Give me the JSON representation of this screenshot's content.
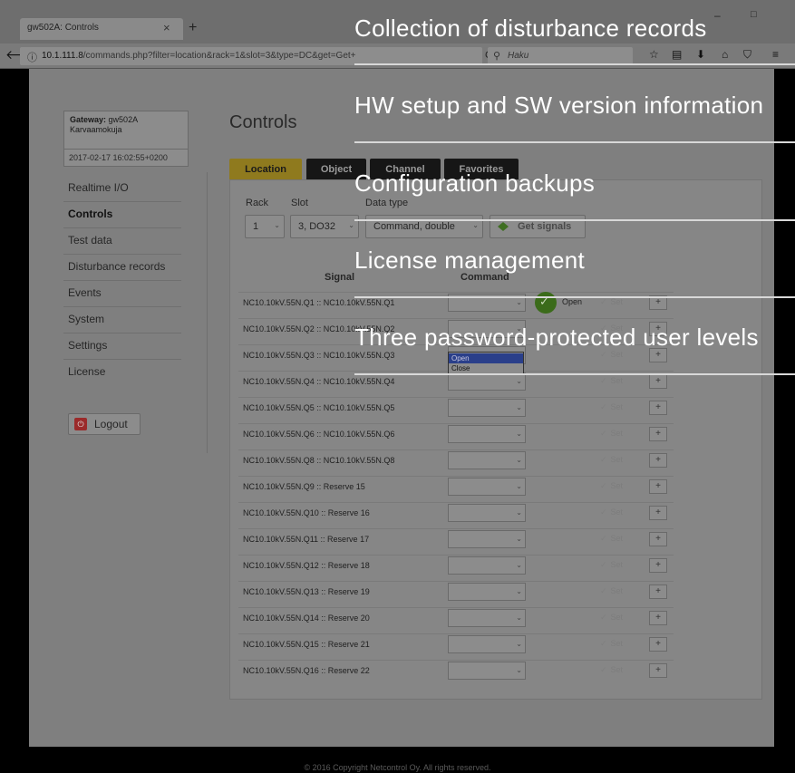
{
  "browser": {
    "tab_title": "gw502A: Controls",
    "tab_close": "×",
    "new_tab": "+",
    "window_min": "–",
    "window_max": "□",
    "url_host": "10.1.111.8",
    "url_path": "/commands.php?filter=location&rack=1&slot=3&type=DC&get=Get+",
    "search_placeholder": "Haku",
    "back": "🡐",
    "info": "ⓘ",
    "reload": "C",
    "search_glyph": "⚲",
    "toolbar_icons": [
      "☆",
      "▤",
      "⬇",
      "⌂",
      "⛉",
      "≡"
    ]
  },
  "gateway": {
    "label": "Gateway:",
    "name": "gw502A",
    "location": "Karvaamokuja",
    "datetime": "2017-02-17 16:02:55+0200"
  },
  "sidebar": {
    "items": [
      {
        "label": "Realtime I/O"
      },
      {
        "label": "Controls"
      },
      {
        "label": "Test data"
      },
      {
        "label": "Disturbance records"
      },
      {
        "label": "Events"
      },
      {
        "label": "System"
      },
      {
        "label": "Settings"
      },
      {
        "label": "License"
      }
    ],
    "logout_label": "Logout",
    "logout_glyph": "⏻"
  },
  "main": {
    "title": "Controls",
    "tabs": [
      {
        "label": "Location"
      },
      {
        "label": "Object"
      },
      {
        "label": "Channel"
      },
      {
        "label": "Favorites"
      }
    ],
    "filters": {
      "rack_label": "Rack",
      "slot_label": "Slot",
      "type_label": "Data type",
      "rack_value": "1",
      "slot_value": "3, DO32",
      "type_value": "Command, double",
      "get_signals_label": "Get signals"
    },
    "table": {
      "signal_header": "Signal",
      "command_header": "Command",
      "set_label": "Set",
      "set_glyph": "✓",
      "plus_label": "+",
      "dropdown_arrow": "⌄",
      "rows": [
        {
          "signal": "NC10.10kV.55N.Q1 :: NC10.10kV.55N.Q1"
        },
        {
          "signal": "NC10.10kV.55N.Q2 :: NC10.10kV.55N.Q2"
        },
        {
          "signal": "NC10.10kV.55N.Q3 :: NC10.10kV.55N.Q3"
        },
        {
          "signal": "NC10.10kV.55N.Q4 :: NC10.10kV.55N.Q4"
        },
        {
          "signal": "NC10.10kV.55N.Q5 :: NC10.10kV.55N.Q5"
        },
        {
          "signal": "NC10.10kV.55N.Q6 :: NC10.10kV.55N.Q6"
        },
        {
          "signal": "NC10.10kV.55N.Q8 :: NC10.10kV.55N.Q8"
        },
        {
          "signal": "NC10.10kV.55N.Q9 :: Reserve 15"
        },
        {
          "signal": "NC10.10kV.55N.Q10 :: Reserve 16"
        },
        {
          "signal": "NC10.10kV.55N.Q11 :: Reserve 17"
        },
        {
          "signal": "NC10.10kV.55N.Q12 :: Reserve 18"
        },
        {
          "signal": "NC10.10kV.55N.Q13 :: Reserve 19"
        },
        {
          "signal": "NC10.10kV.55N.Q14 :: Reserve 20"
        },
        {
          "signal": "NC10.10kV.55N.Q15 :: Reserve 21"
        },
        {
          "signal": "NC10.10kV.55N.Q16 :: Reserve 22"
        }
      ],
      "status_q1": "Open",
      "status_glyph": "✓",
      "dropdown_options": [
        "Open",
        "Close"
      ]
    },
    "copyright": "© 2016 Copyright Netcontrol Oy. All rights reserved."
  },
  "overlay": {
    "items": [
      {
        "text": "Collection of disturbance records"
      },
      {
        "text": "HW setup and SW version information"
      },
      {
        "text": "Configuration backups"
      },
      {
        "text": "License management"
      },
      {
        "text": "Three password-protected user levels"
      }
    ]
  }
}
